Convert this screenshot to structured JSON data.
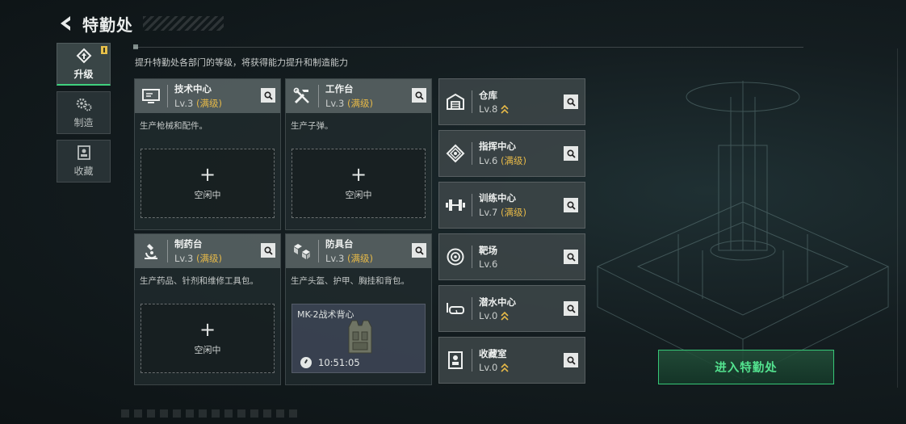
{
  "header": {
    "title": "特勤处"
  },
  "subtitle": "提升特勤处各部门的等级，将获得能力提升和制造能力",
  "nav": [
    {
      "label": "升级",
      "icon": "upgrade-icon",
      "active": true,
      "badge": true
    },
    {
      "label": "制造",
      "icon": "gears-icon",
      "active": false
    },
    {
      "label": "收藏",
      "icon": "collection-icon",
      "active": false
    }
  ],
  "cards": [
    {
      "name": "技术中心",
      "level": "Lv.3",
      "max": "(满级)",
      "desc": "生产枪械和配件。",
      "icon": "monitor-icon",
      "slot": {
        "plus": "+",
        "text": "空闲中"
      }
    },
    {
      "name": "工作台",
      "level": "Lv.3",
      "max": "(满级)",
      "desc": "生产子弹。",
      "icon": "tools-icon",
      "slot": {
        "plus": "+",
        "text": "空闲中"
      }
    },
    {
      "name": "制药台",
      "level": "Lv.3",
      "max": "(满级)",
      "desc": "生产药品、针剂和维修工具包。",
      "icon": "microscope-icon",
      "slot": {
        "plus": "+",
        "text": "空闲中"
      }
    },
    {
      "name": "防具台",
      "level": "Lv.3",
      "max": "(满级)",
      "desc": "生产头盔、护甲、胸挂和背包。",
      "icon": "armor-blocks-icon",
      "production": {
        "item": "MK-2战术背心",
        "time": "10:51:05"
      }
    }
  ],
  "rows": [
    {
      "name": "仓库",
      "level": "Lv.8",
      "max": "",
      "upgradable": true,
      "icon": "warehouse-icon"
    },
    {
      "name": "指挥中心",
      "level": "Lv.6",
      "max": "(满级)",
      "upgradable": false,
      "icon": "command-icon"
    },
    {
      "name": "训练中心",
      "level": "Lv.7",
      "max": "(满级)",
      "upgradable": false,
      "icon": "dumbbell-icon"
    },
    {
      "name": "靶场",
      "level": "Lv.6",
      "max": "",
      "upgradable": false,
      "icon": "target-icon"
    },
    {
      "name": "潜水中心",
      "level": "Lv.0",
      "max": "",
      "upgradable": true,
      "icon": "diving-mask-icon"
    },
    {
      "name": "收藏室",
      "level": "Lv.0",
      "max": "",
      "upgradable": true,
      "icon": "collection-room-icon"
    }
  ],
  "enter_button": "进入特勤处",
  "colors": {
    "accent_green": "#3fd07d",
    "max_gold": "#e6b948",
    "enter_text": "#53e28f"
  }
}
